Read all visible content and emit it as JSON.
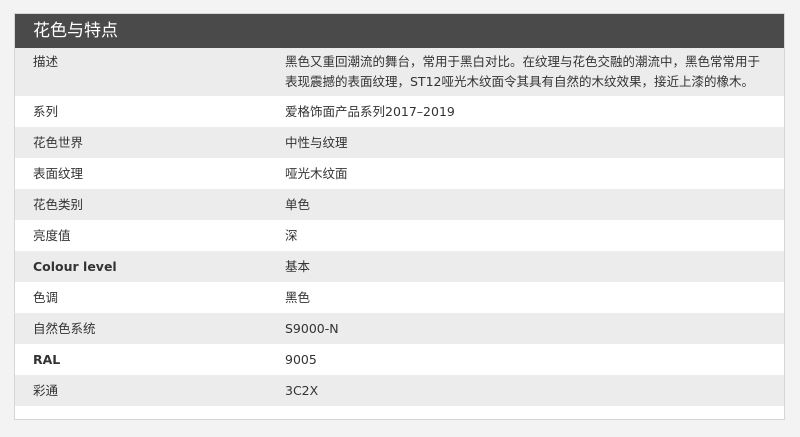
{
  "panel": {
    "title": "花色与特点"
  },
  "rows": [
    {
      "label": "描述",
      "value": "黑色又重回潮流的舞台，常用于黑白对比。在纹理与花色交融的潮流中，黑色常常用于表现震撼的表面纹理，ST12哑光木纹面令其具有自然的木纹效果，接近上漆的橡木。"
    },
    {
      "label": "系列",
      "value": "爱格饰面产品系列2017–2019"
    },
    {
      "label": "花色世界",
      "value": "中性与纹理"
    },
    {
      "label": "表面纹理",
      "value": "哑光木纹面"
    },
    {
      "label": "花色类别",
      "value": "单色"
    },
    {
      "label": "亮度值",
      "value": "深"
    },
    {
      "label": "Colour level",
      "value": "基本"
    },
    {
      "label": "色调",
      "value": "黑色"
    },
    {
      "label": "自然色系统",
      "value": "S9000-N"
    },
    {
      "label": "RAL",
      "value": "9005"
    },
    {
      "label": "彩通",
      "value": "3C2X"
    }
  ]
}
